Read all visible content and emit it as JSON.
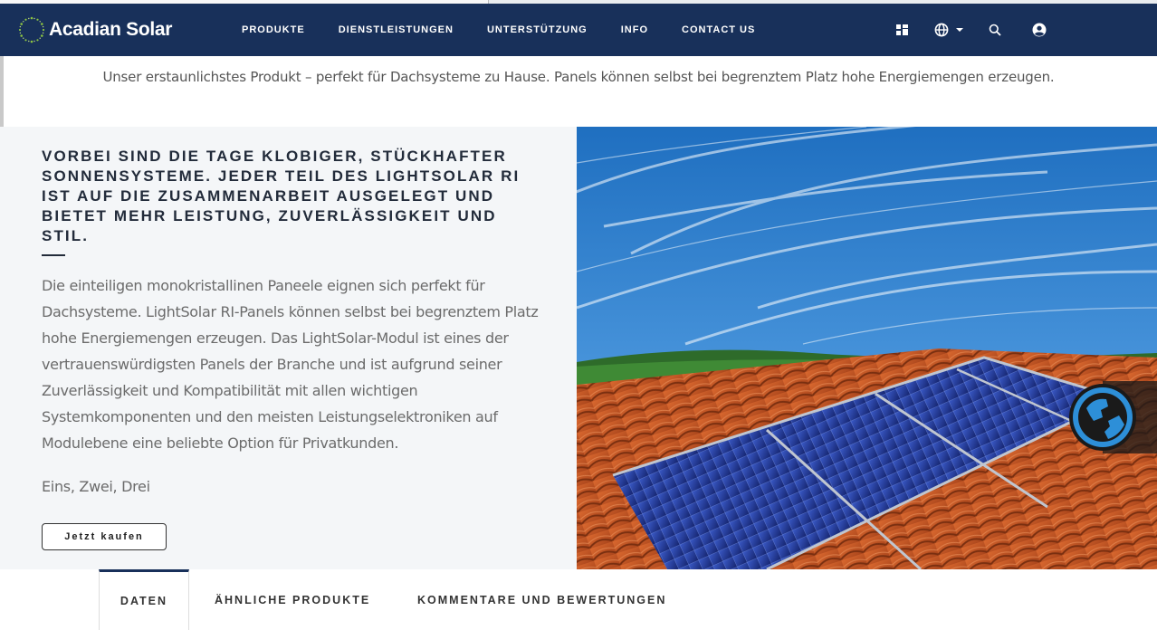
{
  "brand": {
    "name": "Acadian Solar"
  },
  "nav": {
    "links": [
      "PRODUKTE",
      "DIENSTLEISTUNGEN",
      "UNTERSTÜTZUNG",
      "INFO",
      "CONTACT US"
    ],
    "icons": [
      "grid-icon",
      "globe-icon",
      "chevron-down-icon",
      "search-icon",
      "user-icon"
    ]
  },
  "tagline": "Unser erstaunlichstes Produkt – perfekt für Dachsysteme zu Hause. Panels können selbst bei begrenztem Platz hohe Energiemengen erzeugen.",
  "product": {
    "headline": "VORBEI SIND DIE TAGE KLOBIGER, STÜCKHAFTER SONNENSYSTEME. JEDER TEIL DES LIGHTSOLAR RI IST AUF DIE ZUSAMMENARBEIT AUSGELEGT UND BIETET MEHR LEISTUNG, ZUVERLÄSSIGKEIT UND STIL.",
    "description": "Die einteiligen monokristallinen Paneele eignen sich perfekt für Dachsysteme. LightSolar RI-Panels können selbst bei begrenztem Platz hohe Energiemengen erzeugen. Das LightSolar-Modul ist eines der vertrauenswürdigsten Panels der Branche und ist aufgrund seiner Zuverlässigkeit und Kompatibilität mit allen wichtigen Systemkomponenten und den meisten Leistungselektroniken auf Modulebene eine beliebte Option für Privatkunden.",
    "subtext": "Eins, Zwei, Drei",
    "buy_label": "Jetzt kaufen"
  },
  "tabs": [
    {
      "label": "DATEN",
      "active": true
    },
    {
      "label": "ÄHNLICHE PRODUKTE",
      "active": false
    },
    {
      "label": "KOMMENTARE UND BEWERTUNGEN",
      "active": false
    }
  ],
  "colors": {
    "nav_bg": "#18305a",
    "panel_bg": "#f4f6f8",
    "accent": "#2d8fd8"
  }
}
